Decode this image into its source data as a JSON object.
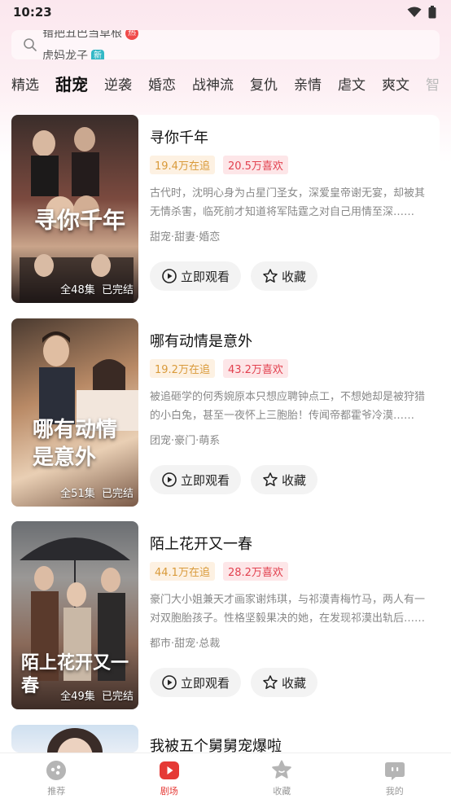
{
  "status_bar": {
    "time": "10:23"
  },
  "search": {
    "ticker": [
      {
        "text": "错把丑巴当草根",
        "badge": "热"
      },
      {
        "text": "虎妈龙子",
        "badge": "新"
      }
    ]
  },
  "tabs": [
    "精选",
    "甜宠",
    "逆袭",
    "婚恋",
    "战神流",
    "复仇",
    "亲情",
    "虐文",
    "爽文",
    "智"
  ],
  "active_tab": "甜宠",
  "dramas": [
    {
      "title": "寻你千年",
      "follow": "19.4万在追",
      "likes": "20.5万喜欢",
      "description": "古代时，沈明心身为占星门圣女，深爱皇帝谢无宴，却被其无情杀害，临死前才知道将军陆霆之对自己用情至深……",
      "tags": "甜宠·甜妻·婚恋",
      "episodes": "全48集",
      "status": "已完结",
      "poster_title": "寻你千年",
      "poster_colors": [
        "#3a2d2a",
        "#7b4a3f",
        "#c9a48a"
      ]
    },
    {
      "title": "哪有动情是意外",
      "follow": "19.2万在追",
      "likes": "43.2万喜欢",
      "description": "被追砸学的何秀婉原本只想应聘钟点工，不想她却是被狩猎的小白兔，甚至一夜怀上三胞胎！传闻帝都霍爷冷漠……",
      "tags": "团宠·豪门·萌系",
      "episodes": "全51集",
      "status": "已完结",
      "poster_title": "哪有动情是意外",
      "poster_colors": [
        "#6a4a3a",
        "#b98a66",
        "#e9cfb4"
      ]
    },
    {
      "title": "陌上花开又一春",
      "follow": "44.1万在追",
      "likes": "28.2万喜欢",
      "description": "豪门大小姐兼天才画家谢炜琪，与祁漠青梅竹马，两人有一对双胞胎孩子。性格坚毅果决的她，在发现祁漠出轨后……",
      "tags": "都市·甜宠·总裁",
      "episodes": "全49集",
      "status": "已完结",
      "poster_title": "陌上花开又一春",
      "poster_colors": [
        "#3d3a3a",
        "#8a6a5a",
        "#cfc6c0"
      ]
    },
    {
      "title": "我被五个舅舅宠爆啦",
      "poster_colors": [
        "#cfe0f0",
        "#e8eef6",
        "#f5f7fa"
      ]
    }
  ],
  "actions": {
    "watch": "立即观看",
    "favorite": "收藏"
  },
  "bottom_nav": [
    {
      "label": "推荐",
      "icon": "game-icon"
    },
    {
      "label": "剧场",
      "icon": "play-icon"
    },
    {
      "label": "收藏",
      "icon": "star-icon"
    },
    {
      "label": "我的",
      "icon": "face-icon"
    }
  ],
  "active_nav": "剧场",
  "colors": {
    "accent": "#e53935",
    "follow": "#d99a3a",
    "like": "#e2414f"
  }
}
